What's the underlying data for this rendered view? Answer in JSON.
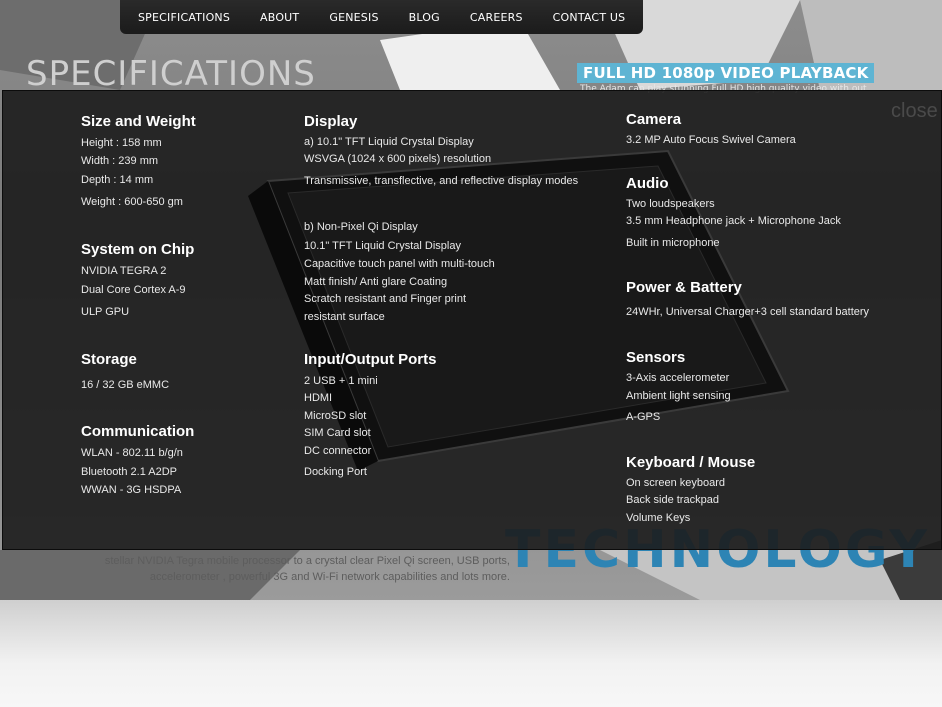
{
  "nav": {
    "items": [
      "SPECIFICATIONS",
      "ABOUT",
      "GENESIS",
      "BLOG",
      "CAREERS",
      "CONTACT US"
    ]
  },
  "background": {
    "page_title": "SPECIFICATIONS",
    "feature_tag": "FULL HD 1080p VIDEO PLAYBACK",
    "feature_sub": "The Adam can play stunning Full HD high quality video with out",
    "technology_word": "TECHNOLOGY",
    "description_line1": "stellar NVIDIA Tegra mobile processor to a crystal clear Pixel Qi screen, USB ports,",
    "description_line2": "accelerometer , powerful 3G and Wi-Fi network capabilities and lots more."
  },
  "overlay": {
    "close_label": "close",
    "col1": {
      "size_title": "Size and Weight",
      "size_lines": [
        "Height : 158 mm",
        "Width : 239 mm",
        "Depth : 14 mm",
        "Weight : 600-650 gm"
      ],
      "soc_title": "System on Chip",
      "soc_lines": [
        "NVIDIA TEGRA 2",
        "Dual Core Cortex A-9",
        "ULP GPU"
      ],
      "storage_title": "Storage",
      "storage_lines": [
        "16 / 32 GB eMMC"
      ],
      "comm_title": "Communication",
      "comm_lines": [
        "WLAN - 802.11 b/g/n",
        "Bluetooth 2.1 A2DP",
        "WWAN - 3G HSDPA"
      ]
    },
    "col2": {
      "display_title": "Display",
      "display_lines": [
        "a) 10.1\" TFT Liquid Crystal Display",
        "WSVGA (1024 x 600 pixels) resolution",
        "Transmissive, transflective, and reflective display modes",
        "b) Non-Pixel Qi Display",
        "10.1\" TFT Liquid Crystal Display",
        "Capacitive touch panel with multi-touch",
        "Matt finish/ Anti glare Coating",
        "Scratch resistant and Finger print",
        "resistant surface"
      ],
      "io_title": "Input/Output Ports",
      "io_lines": [
        "2 USB + 1 mini",
        "HDMI",
        "MicroSD slot",
        "SIM Card slot",
        "DC connector",
        "Docking Port"
      ]
    },
    "col3": {
      "camera_title": "Camera",
      "camera_lines": [
        "3.2 MP Auto Focus Swivel Camera"
      ],
      "audio_title": "Audio",
      "audio_lines": [
        "Two loudspeakers",
        "3.5 mm Headphone jack + Microphone Jack",
        "Built in microphone"
      ],
      "power_title": "Power & Battery",
      "power_lines": [
        "24WHr, Universal Charger+3 cell standard battery"
      ],
      "sensors_title": "Sensors",
      "sensors_lines": [
        "3-Axis accelerometer",
        "Ambient light sensing",
        "A-GPS"
      ],
      "keyboard_title": "Keyboard / Mouse",
      "keyboard_lines": [
        "On screen keyboard",
        "Back side trackpad",
        "Volume Keys"
      ]
    }
  },
  "colors": {
    "accent": "#5eb4d3",
    "technology_blue": "#2d84b4",
    "overlay_bg": "#1c1c1c"
  }
}
